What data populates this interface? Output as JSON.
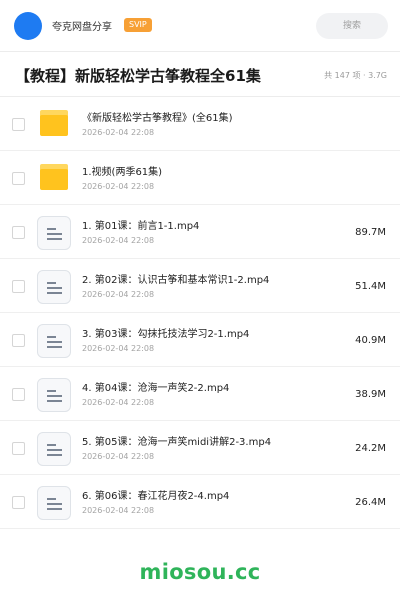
{
  "header": {
    "app_name": "夸克网盘分享",
    "badge": "SVIP",
    "search_placeholder": "搜索"
  },
  "title_bar": {
    "title": "【教程】新版轻松学古筝教程全61集",
    "meta": "共 147 项 · 3.7G"
  },
  "files": [
    {
      "type": "folder",
      "name": "《新版轻松学古筝教程》(全61集)",
      "date": "2026-02-04 22:08",
      "size": ""
    },
    {
      "type": "folder",
      "name": "1.视频(两季61集)",
      "date": "2026-02-04 22:08",
      "size": ""
    },
    {
      "type": "file",
      "name": "1. 第01课：前言1-1.mp4",
      "date": "2026-02-04 22:08",
      "size": "89.7M"
    },
    {
      "type": "file",
      "name": "2. 第02课：认识古筝和基本常识1-2.mp4",
      "date": "2026-02-04 22:08",
      "size": "51.4M"
    },
    {
      "type": "file",
      "name": "3. 第03课：勾抹托技法学习2-1.mp4",
      "date": "2026-02-04 22:08",
      "size": "40.9M"
    },
    {
      "type": "file",
      "name": "4. 第04课：沧海一声笑2-2.mp4",
      "date": "2026-02-04 22:08",
      "size": "38.9M"
    },
    {
      "type": "file",
      "name": "5. 第05课：沧海一声笑midi讲解2-3.mp4",
      "date": "2026-02-04 22:08",
      "size": "24.2M"
    },
    {
      "type": "file",
      "name": "6. 第06课：春江花月夜2-4.mp4",
      "date": "2026-02-04 22:08",
      "size": "26.4M"
    }
  ],
  "watermark": "miosou.cc",
  "colors": {
    "avatar": "#1e7bf2",
    "badge": "#f7a035",
    "folder": "#ffc31e",
    "watermark": "#2fb45a"
  },
  "icons": {
    "folder": "folder-icon",
    "file": "video-file-icon"
  }
}
